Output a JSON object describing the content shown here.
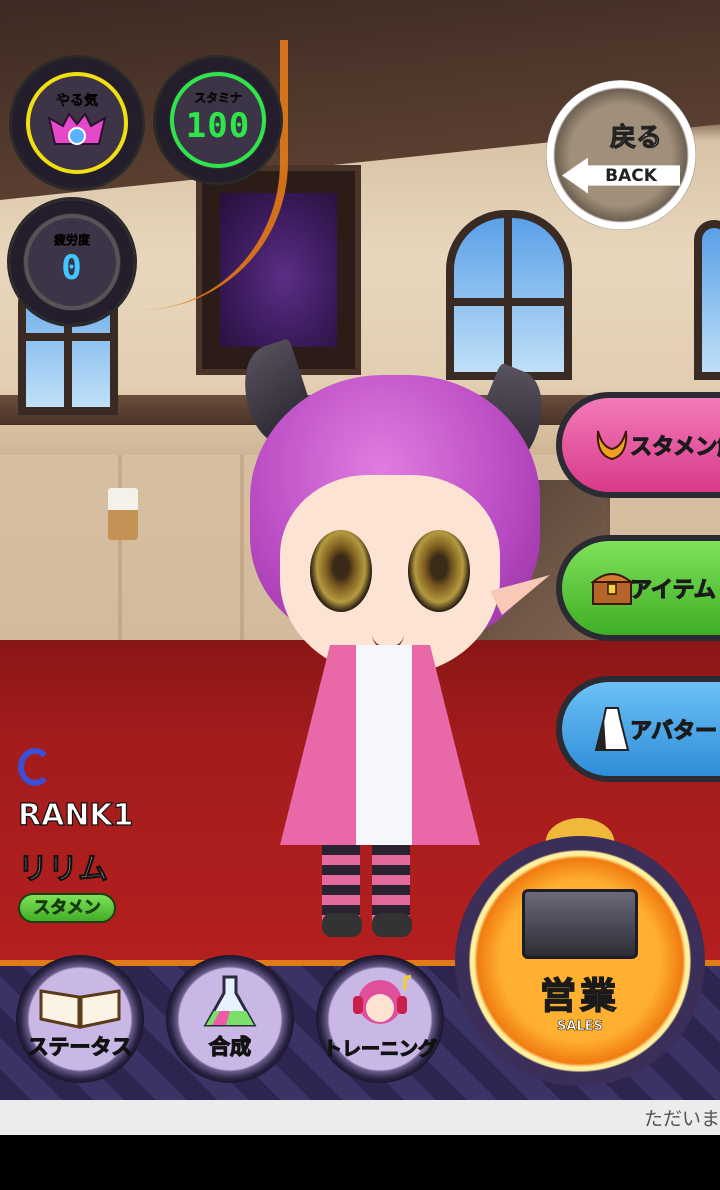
{
  "hud": {
    "motivation": {
      "label": "やる気",
      "icon": "demon-face-icon",
      "ring_color": "#f0e010"
    },
    "stamina": {
      "label": "スタミナ",
      "value": "100",
      "ring_color": "#2ee64a",
      "value_color": "#2ee64a"
    },
    "fatigue": {
      "label": "疲労度",
      "value": "0",
      "value_color": "#3fc8ff"
    }
  },
  "back_button": {
    "label_jp": "戻る",
    "label_en": "BACK"
  },
  "side_menu": [
    {
      "label": "スタメン解除",
      "icon": "demon-horns-icon",
      "color": "#e8549e"
    },
    {
      "label": "アイテム",
      "icon": "treasure-chest-icon",
      "color": "#58c84a"
    },
    {
      "label": "アバター",
      "icon": "dress-icon",
      "color": "#4aa8e8"
    }
  ],
  "character": {
    "grade": "C",
    "rank": "RANK1",
    "name": "リリム",
    "badge": "スタメン"
  },
  "bottom_nav": [
    {
      "label": "ステータス",
      "icon": "book-icon"
    },
    {
      "label": "合成",
      "icon": "flask-icon"
    },
    {
      "label": "トレーニング",
      "icon": "headphones-girl-icon"
    }
  ],
  "sales_button": {
    "label_jp": "営業",
    "label_en": "SALES",
    "icon": "shop-stage-icon"
  },
  "footer": {
    "text": "ただいま"
  }
}
